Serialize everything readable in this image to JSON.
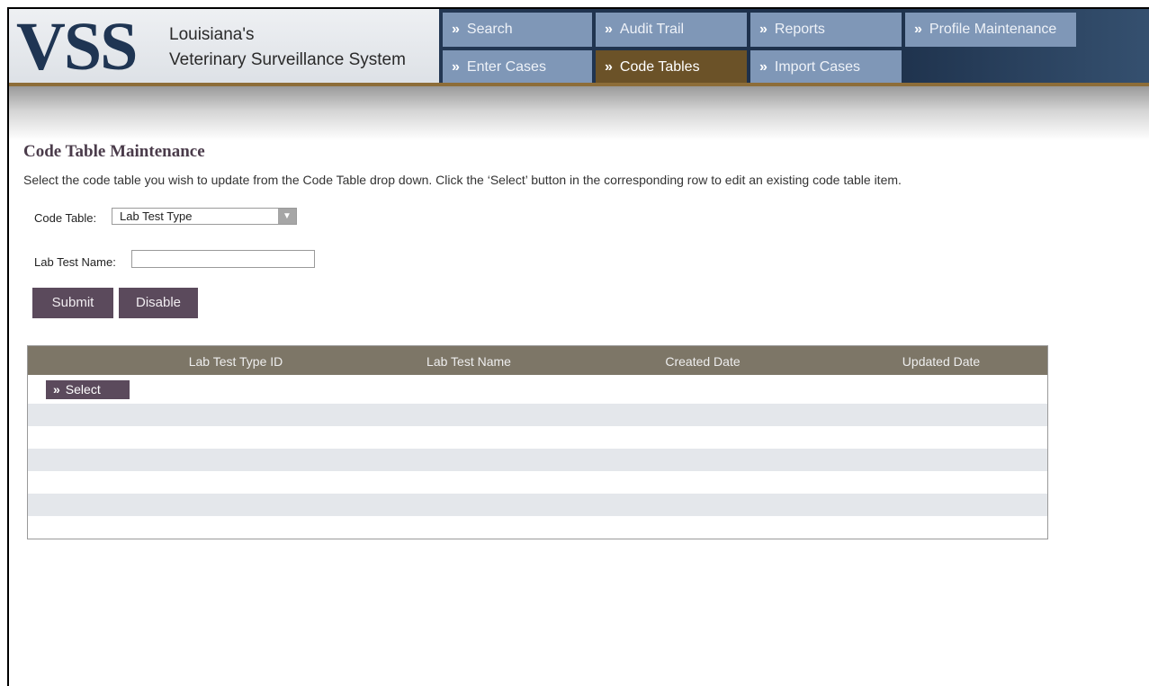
{
  "header": {
    "logo_mark": "VSS",
    "logo_line1": "Louisiana's",
    "logo_line2": "Veterinary Surveillance System"
  },
  "nav": {
    "search": "Search",
    "audit_trail": "Audit Trail",
    "reports": "Reports",
    "profile_maintenance": "Profile Maintenance",
    "enter_cases": "Enter Cases",
    "code_tables": "Code Tables",
    "import_cases": "Import Cases",
    "active_tab": "Code Tables"
  },
  "page": {
    "title": "Code Table Maintenance",
    "instructions": "Select the code table you wish to update from the Code Table drop down.  Click the ‘Select’ button in the corresponding row to edit an existing code table item."
  },
  "form": {
    "code_table_label": "Code Table:",
    "code_table_value": "Lab Test Type",
    "lab_test_name_label": "Lab Test Name:",
    "lab_test_name_value": "",
    "submit_label": "Submit",
    "disable_label": "Disable"
  },
  "grid": {
    "columns": [
      "Lab Test Type ID",
      "Lab Test Name",
      "Created Date",
      "Updated Date"
    ],
    "select_label": "Select"
  },
  "icons": {
    "nav_chevron": "double-chevron-right-icon",
    "select_arrow": "chevron-down-icon"
  },
  "colors": {
    "nav_tab": "#7f97b7",
    "nav_active": "#6b5228",
    "button": "#5b4a5c",
    "grid_header": "#7d7667",
    "grid_alt_row": "#e4e7eb"
  }
}
